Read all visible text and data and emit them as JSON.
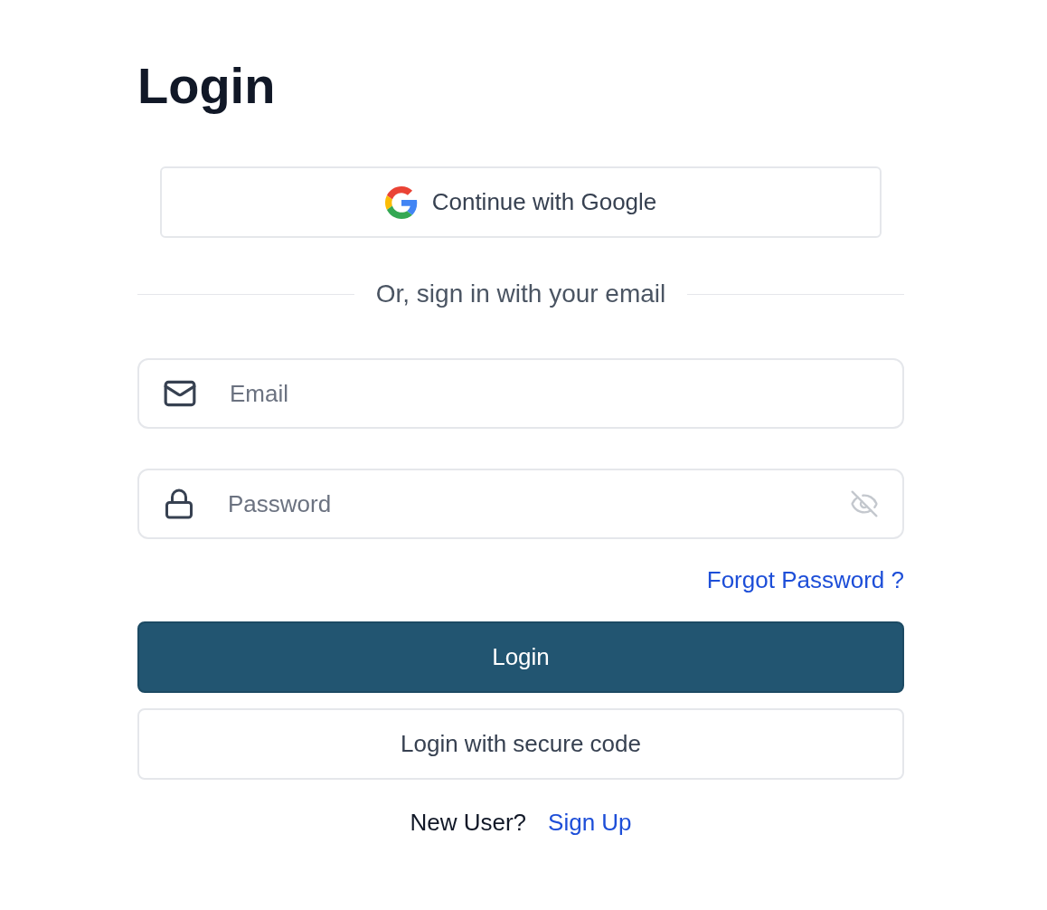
{
  "title": "Login",
  "google_button": {
    "label": "Continue with Google"
  },
  "divider": {
    "text": "Or, sign in with your email"
  },
  "fields": [
    {
      "kind": "email",
      "placeholder": "Email"
    },
    {
      "kind": "password",
      "placeholder": "Password"
    }
  ],
  "forgot_link": "Forgot Password ?",
  "buttons": [
    {
      "kind": "primary",
      "label": "Login"
    },
    {
      "kind": "secondary",
      "label": "Login with secure code"
    }
  ],
  "footer": {
    "prompt": "New User?",
    "link": "Sign Up"
  }
}
